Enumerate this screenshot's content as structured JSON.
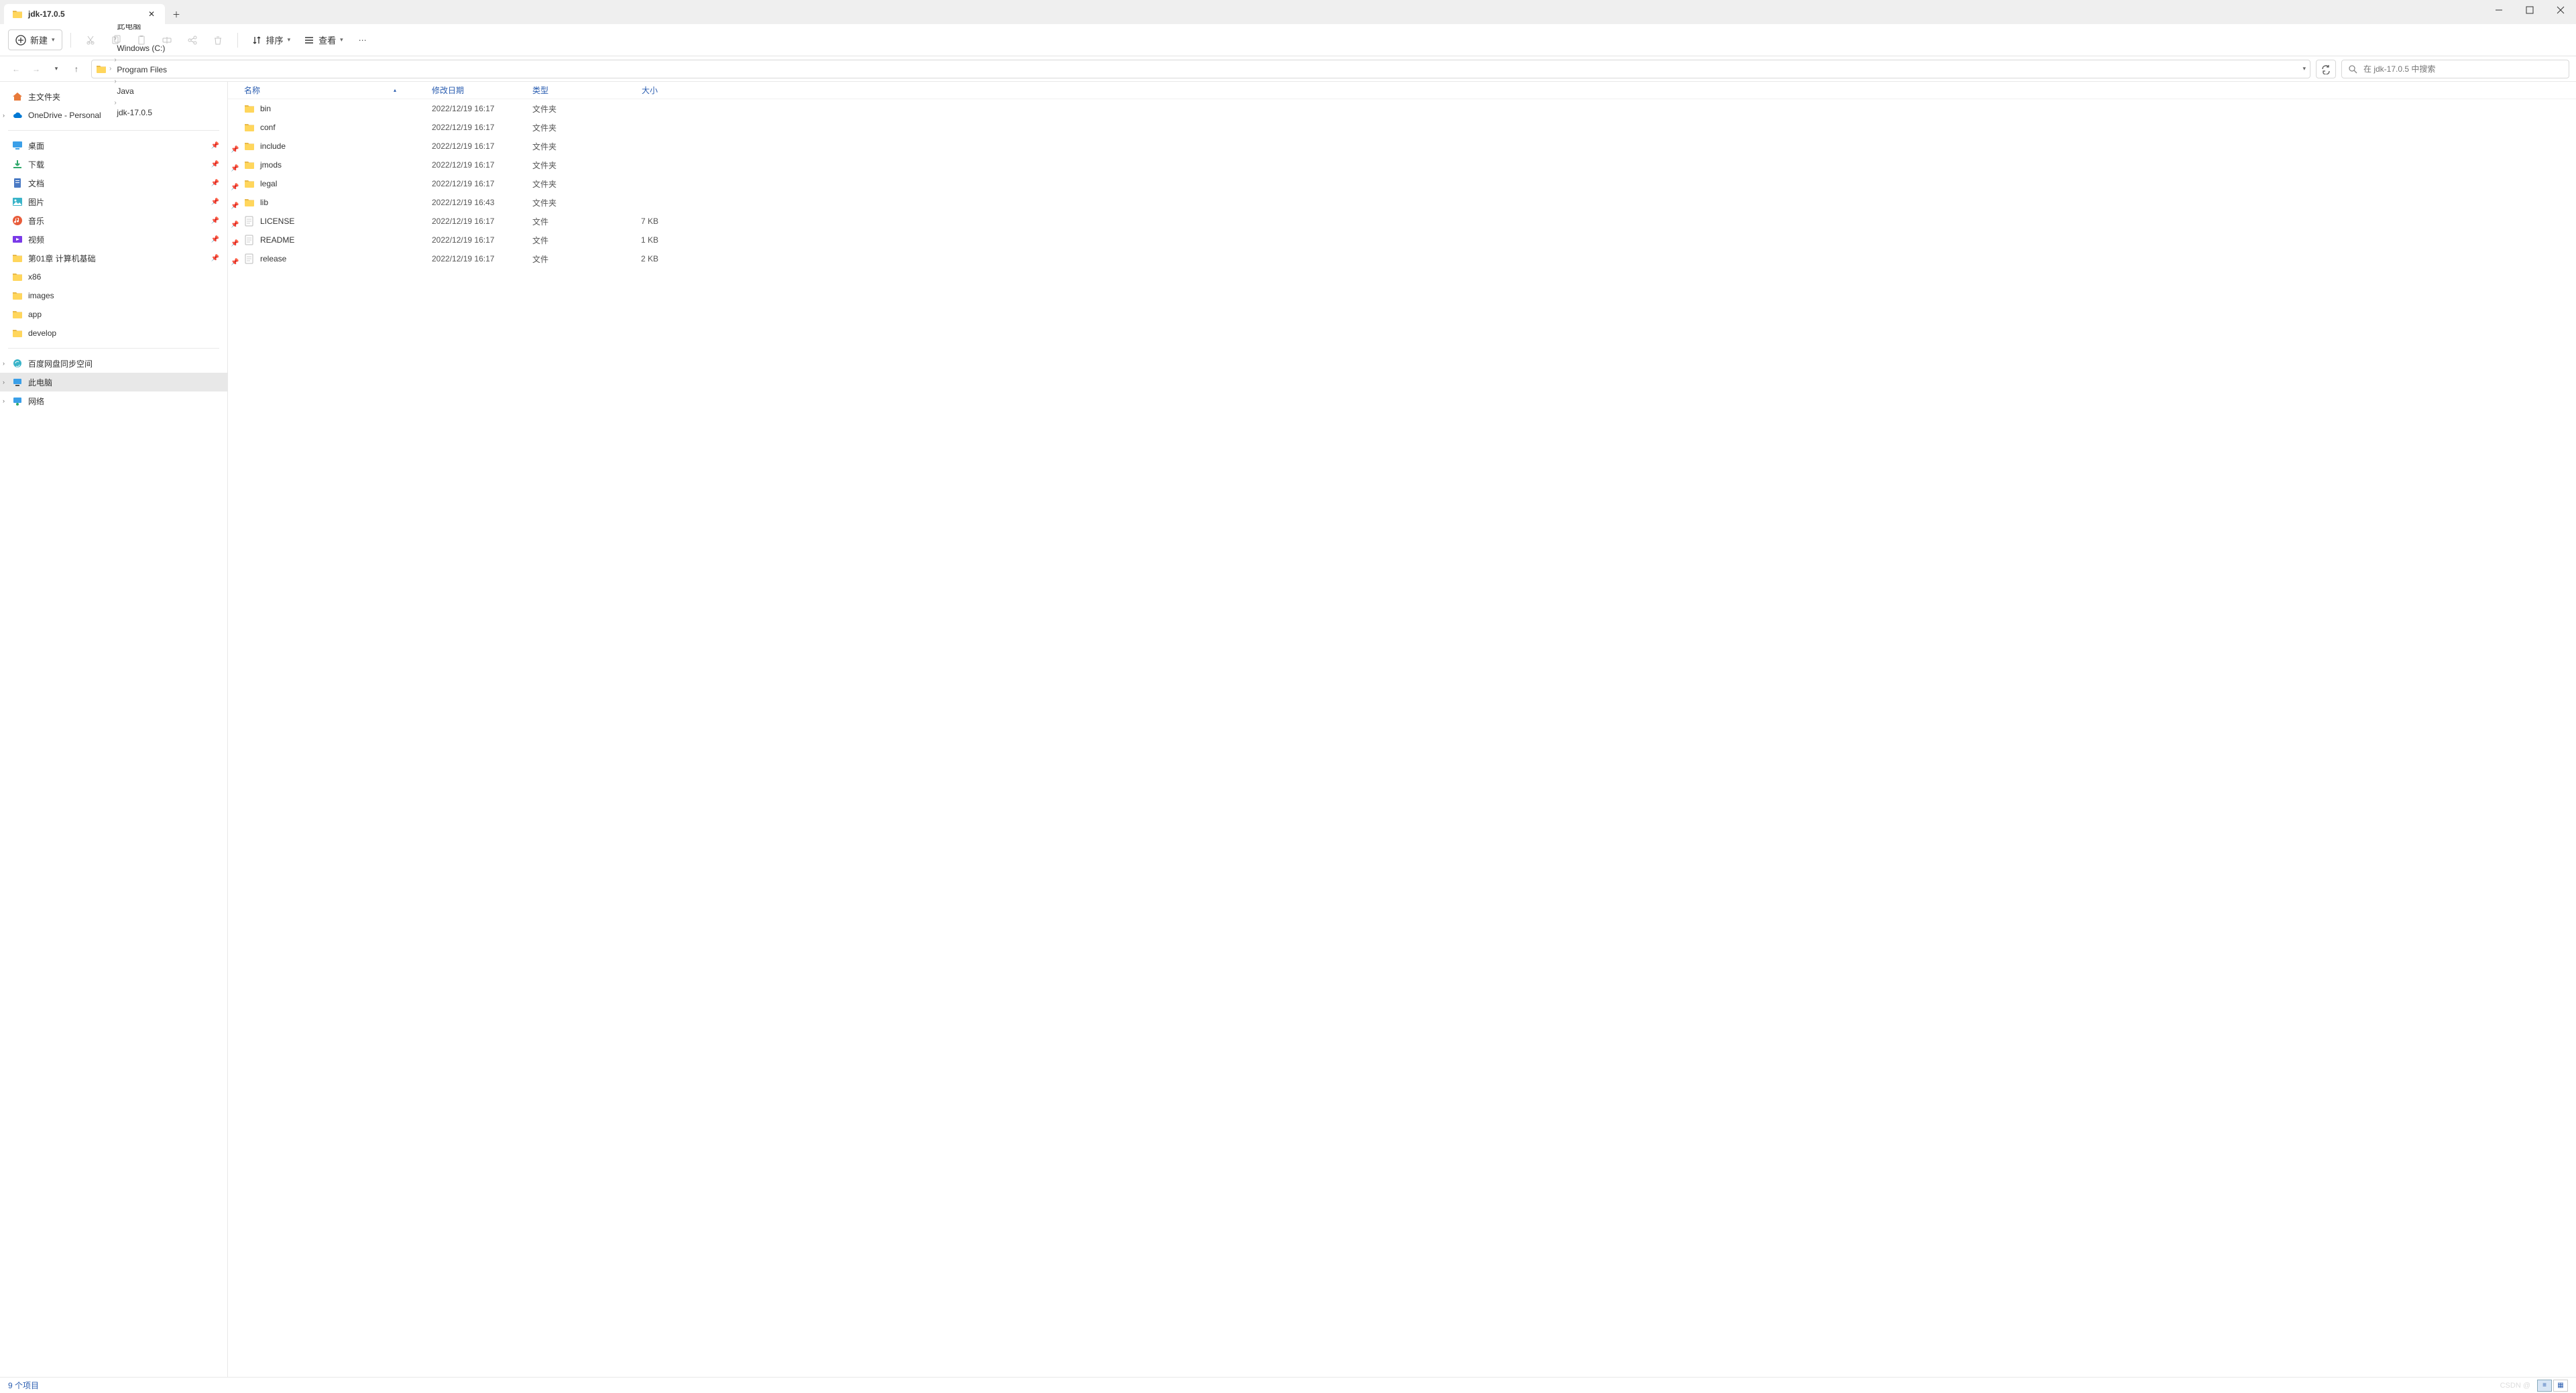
{
  "tab": {
    "title": "jdk-17.0.5"
  },
  "toolbar": {
    "new_label": "新建",
    "sort_label": "排序",
    "view_label": "查看"
  },
  "breadcrumb": {
    "items": [
      "此电脑",
      "Windows (C:)",
      "Program Files",
      "Java",
      "jdk-17.0.5"
    ]
  },
  "search": {
    "placeholder": "在 jdk-17.0.5 中搜索"
  },
  "sidebar": {
    "home": "主文件夹",
    "onedrive": "OneDrive - Personal",
    "quick": [
      {
        "icon": "desktop",
        "label": "桌面",
        "pinned": true
      },
      {
        "icon": "download",
        "label": "下载",
        "pinned": true
      },
      {
        "icon": "document",
        "label": "文档",
        "pinned": true
      },
      {
        "icon": "picture",
        "label": "图片",
        "pinned": true
      },
      {
        "icon": "music",
        "label": "音乐",
        "pinned": true
      },
      {
        "icon": "video",
        "label": "视频",
        "pinned": true
      },
      {
        "icon": "folder",
        "label": "第01章 计算机基础",
        "pinned": true
      },
      {
        "icon": "folder",
        "label": "x86",
        "pinned": false
      },
      {
        "icon": "folder",
        "label": "images",
        "pinned": false
      },
      {
        "icon": "folder",
        "label": "app",
        "pinned": false
      },
      {
        "icon": "folder",
        "label": "develop",
        "pinned": false
      }
    ],
    "bottom": [
      {
        "icon": "sync",
        "label": "百度网盘同步空间",
        "expand": true
      },
      {
        "icon": "pc",
        "label": "此电脑",
        "expand": true,
        "selected": true
      },
      {
        "icon": "network",
        "label": "网络",
        "expand": true
      }
    ]
  },
  "columns": {
    "name": "名称",
    "date": "修改日期",
    "type": "类型",
    "size": "大小"
  },
  "files": [
    {
      "icon": "folder",
      "name": "bin",
      "date": "2022/12/19 16:17",
      "type": "文件夹",
      "size": ""
    },
    {
      "icon": "folder",
      "name": "conf",
      "date": "2022/12/19 16:17",
      "type": "文件夹",
      "size": ""
    },
    {
      "icon": "folder",
      "name": "include",
      "date": "2022/12/19 16:17",
      "type": "文件夹",
      "size": "",
      "pinned": true
    },
    {
      "icon": "folder",
      "name": "jmods",
      "date": "2022/12/19 16:17",
      "type": "文件夹",
      "size": "",
      "pinned": true
    },
    {
      "icon": "folder",
      "name": "legal",
      "date": "2022/12/19 16:17",
      "type": "文件夹",
      "size": "",
      "pinned": true
    },
    {
      "icon": "folder",
      "name": "lib",
      "date": "2022/12/19 16:43",
      "type": "文件夹",
      "size": "",
      "pinned": true
    },
    {
      "icon": "file",
      "name": "LICENSE",
      "date": "2022/12/19 16:17",
      "type": "文件",
      "size": "7 KB",
      "pinned": true
    },
    {
      "icon": "file",
      "name": "README",
      "date": "2022/12/19 16:17",
      "type": "文件",
      "size": "1 KB",
      "pinned": true
    },
    {
      "icon": "file",
      "name": "release",
      "date": "2022/12/19 16:17",
      "type": "文件",
      "size": "2 KB",
      "pinned": true
    }
  ],
  "statusbar": {
    "count": "9 个项目",
    "watermark": "CSDN @"
  }
}
